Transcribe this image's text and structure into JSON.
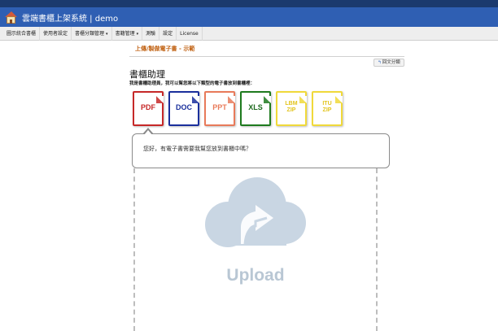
{
  "header": {
    "title": "雲端書櫃上架系統 | demo"
  },
  "nav": {
    "items": [
      {
        "label": "圖示統合書櫃",
        "dropdown": false
      },
      {
        "label": "使用者設定",
        "dropdown": false
      },
      {
        "label": "書櫃分類管理",
        "dropdown": true
      },
      {
        "label": "書籍管理",
        "dropdown": true
      },
      {
        "label": "測驗",
        "dropdown": false
      },
      {
        "label": "設定",
        "dropdown": false
      },
      {
        "label": "License",
        "dropdown": false
      }
    ],
    "caret": "▾"
  },
  "breadcrumb": "上傳/製做電子書 - 示範",
  "back_button": {
    "icon": "↰",
    "label": "回文分類"
  },
  "page_title": "書櫃助理",
  "subtitle": "我是書櫃助理員，我可以幫您將以下類型的電子書放到書櫃裡：",
  "file_types": [
    {
      "label": "PDF",
      "color": "#c62828",
      "text_color": "#c62828"
    },
    {
      "label": "DOC",
      "color": "#1a2f9c",
      "text_color": "#1a2f9c"
    },
    {
      "label": "PPT",
      "color": "#e87a5a",
      "text_color": "#e87a5a"
    },
    {
      "label": "XLS",
      "color": "#1e7a1e",
      "text_color": "#1e6a1e"
    },
    {
      "label": "LBM\nZIP",
      "color": "#f0d93a",
      "text_color": "#e2c41e"
    },
    {
      "label": "ITU\nZIP",
      "color": "#f0d93a",
      "text_color": "#e2c41e"
    }
  ],
  "assistant_message": "您好，有電子書需要我幫您放到書櫃中嗎？",
  "upload": {
    "label": "Upload",
    "cloud_color": "#c9d6e3"
  }
}
